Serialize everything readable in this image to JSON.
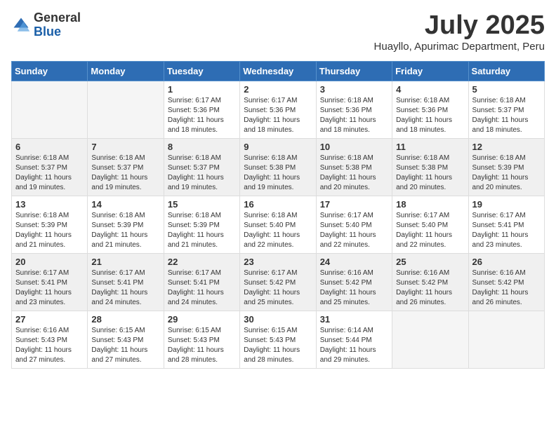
{
  "header": {
    "logo_general": "General",
    "logo_blue": "Blue",
    "month_title": "July 2025",
    "location": "Huayllo, Apurimac Department, Peru"
  },
  "weekdays": [
    "Sunday",
    "Monday",
    "Tuesday",
    "Wednesday",
    "Thursday",
    "Friday",
    "Saturday"
  ],
  "weeks": [
    [
      {
        "day": "",
        "empty": true
      },
      {
        "day": "",
        "empty": true
      },
      {
        "day": "1",
        "sunrise": "6:17 AM",
        "sunset": "5:36 PM",
        "daylight": "11 hours and 18 minutes."
      },
      {
        "day": "2",
        "sunrise": "6:17 AM",
        "sunset": "5:36 PM",
        "daylight": "11 hours and 18 minutes."
      },
      {
        "day": "3",
        "sunrise": "6:18 AM",
        "sunset": "5:36 PM",
        "daylight": "11 hours and 18 minutes."
      },
      {
        "day": "4",
        "sunrise": "6:18 AM",
        "sunset": "5:36 PM",
        "daylight": "11 hours and 18 minutes."
      },
      {
        "day": "5",
        "sunrise": "6:18 AM",
        "sunset": "5:37 PM",
        "daylight": "11 hours and 18 minutes."
      }
    ],
    [
      {
        "day": "6",
        "sunrise": "6:18 AM",
        "sunset": "5:37 PM",
        "daylight": "11 hours and 19 minutes."
      },
      {
        "day": "7",
        "sunrise": "6:18 AM",
        "sunset": "5:37 PM",
        "daylight": "11 hours and 19 minutes."
      },
      {
        "day": "8",
        "sunrise": "6:18 AM",
        "sunset": "5:37 PM",
        "daylight": "11 hours and 19 minutes."
      },
      {
        "day": "9",
        "sunrise": "6:18 AM",
        "sunset": "5:38 PM",
        "daylight": "11 hours and 19 minutes."
      },
      {
        "day": "10",
        "sunrise": "6:18 AM",
        "sunset": "5:38 PM",
        "daylight": "11 hours and 20 minutes."
      },
      {
        "day": "11",
        "sunrise": "6:18 AM",
        "sunset": "5:38 PM",
        "daylight": "11 hours and 20 minutes."
      },
      {
        "day": "12",
        "sunrise": "6:18 AM",
        "sunset": "5:39 PM",
        "daylight": "11 hours and 20 minutes."
      }
    ],
    [
      {
        "day": "13",
        "sunrise": "6:18 AM",
        "sunset": "5:39 PM",
        "daylight": "11 hours and 21 minutes."
      },
      {
        "day": "14",
        "sunrise": "6:18 AM",
        "sunset": "5:39 PM",
        "daylight": "11 hours and 21 minutes."
      },
      {
        "day": "15",
        "sunrise": "6:18 AM",
        "sunset": "5:39 PM",
        "daylight": "11 hours and 21 minutes."
      },
      {
        "day": "16",
        "sunrise": "6:18 AM",
        "sunset": "5:40 PM",
        "daylight": "11 hours and 22 minutes."
      },
      {
        "day": "17",
        "sunrise": "6:17 AM",
        "sunset": "5:40 PM",
        "daylight": "11 hours and 22 minutes."
      },
      {
        "day": "18",
        "sunrise": "6:17 AM",
        "sunset": "5:40 PM",
        "daylight": "11 hours and 22 minutes."
      },
      {
        "day": "19",
        "sunrise": "6:17 AM",
        "sunset": "5:41 PM",
        "daylight": "11 hours and 23 minutes."
      }
    ],
    [
      {
        "day": "20",
        "sunrise": "6:17 AM",
        "sunset": "5:41 PM",
        "daylight": "11 hours and 23 minutes."
      },
      {
        "day": "21",
        "sunrise": "6:17 AM",
        "sunset": "5:41 PM",
        "daylight": "11 hours and 24 minutes."
      },
      {
        "day": "22",
        "sunrise": "6:17 AM",
        "sunset": "5:41 PM",
        "daylight": "11 hours and 24 minutes."
      },
      {
        "day": "23",
        "sunrise": "6:17 AM",
        "sunset": "5:42 PM",
        "daylight": "11 hours and 25 minutes."
      },
      {
        "day": "24",
        "sunrise": "6:16 AM",
        "sunset": "5:42 PM",
        "daylight": "11 hours and 25 minutes."
      },
      {
        "day": "25",
        "sunrise": "6:16 AM",
        "sunset": "5:42 PM",
        "daylight": "11 hours and 26 minutes."
      },
      {
        "day": "26",
        "sunrise": "6:16 AM",
        "sunset": "5:42 PM",
        "daylight": "11 hours and 26 minutes."
      }
    ],
    [
      {
        "day": "27",
        "sunrise": "6:16 AM",
        "sunset": "5:43 PM",
        "daylight": "11 hours and 27 minutes."
      },
      {
        "day": "28",
        "sunrise": "6:15 AM",
        "sunset": "5:43 PM",
        "daylight": "11 hours and 27 minutes."
      },
      {
        "day": "29",
        "sunrise": "6:15 AM",
        "sunset": "5:43 PM",
        "daylight": "11 hours and 28 minutes."
      },
      {
        "day": "30",
        "sunrise": "6:15 AM",
        "sunset": "5:43 PM",
        "daylight": "11 hours and 28 minutes."
      },
      {
        "day": "31",
        "sunrise": "6:14 AM",
        "sunset": "5:44 PM",
        "daylight": "11 hours and 29 minutes."
      },
      {
        "day": "",
        "empty": true
      },
      {
        "day": "",
        "empty": true
      }
    ]
  ],
  "labels": {
    "sunrise": "Sunrise:",
    "sunset": "Sunset:",
    "daylight": "Daylight:"
  }
}
